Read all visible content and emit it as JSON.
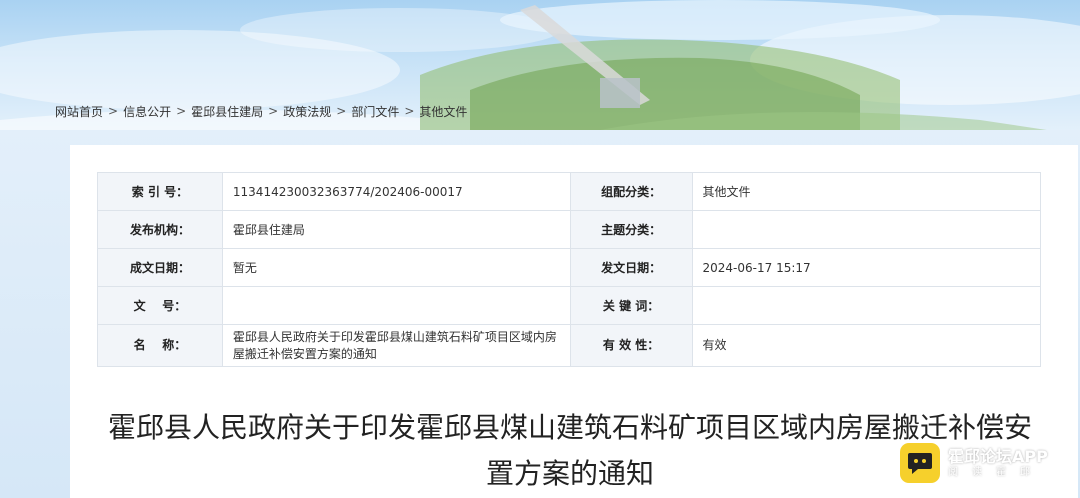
{
  "breadcrumb": {
    "items": [
      "网站首页",
      "信息公开",
      "霍邱县住建局",
      "政策法规",
      "部门文件",
      "其他文件"
    ],
    "separator": ">"
  },
  "meta": {
    "index_label": "索 引 号：",
    "index_value": "113414230032363774/202406-00017",
    "category_label": "组配分类：",
    "category_value": "其他文件",
    "publisher_label": "发布机构：",
    "publisher_value": "霍邱县住建局",
    "topic_label": "主题分类：",
    "topic_value": "",
    "date_label": "成文日期：",
    "date_value": "暂无",
    "pubdate_label": "发文日期：",
    "pubdate_value": "2024-06-17 15:17",
    "docno_label": "文    号：",
    "docno_value": "",
    "keywords_label": "关 键 词：",
    "keywords_value": "",
    "name_label": "名    称：",
    "name_value": "霍邱县人民政府关于印发霍邱县煤山建筑石料矿项目区域内房屋搬迁补偿安置方案的通知",
    "validity_label": "有 效 性：",
    "validity_value": "有效"
  },
  "article": {
    "title": "霍邱县人民政府关于印发霍邱县煤山建筑石料矿项目区域内房屋搬迁补偿安置方案的通知"
  },
  "watermark": {
    "title": "霍邱论坛APP",
    "subtitle": "阅读霍邱",
    "logo_icon": "chat-bubble-icon"
  },
  "colors": {
    "sky": "#a9d2f2",
    "label_bg": "#f2f5f9",
    "border": "#dde3ea",
    "logo_yellow": "#f6d02c"
  }
}
